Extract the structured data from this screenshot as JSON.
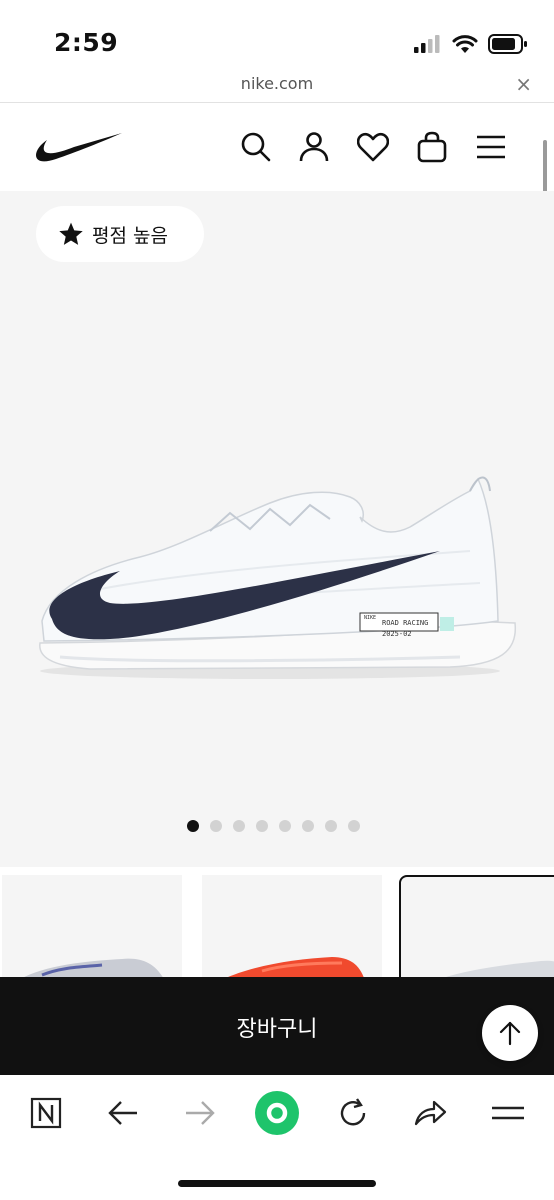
{
  "status_bar": {
    "time": "2:59"
  },
  "url_bar": {
    "domain": "nike.com",
    "close_glyph": "×"
  },
  "header": {
    "logo": "nike-swoosh-logo",
    "icons": [
      "search-icon",
      "account-icon",
      "favorites-heart-icon",
      "bag-icon",
      "menu-icon"
    ]
  },
  "gallery": {
    "badge_label": "평점 높음",
    "badge_icon": "star-icon",
    "dots_count": 8,
    "active_dot": 1,
    "shoe_label_line1": "ROAD RACING",
    "shoe_label_line2": "2025-02",
    "shoe_label_brand": "NIKE"
  },
  "thumbnails": [
    {
      "color": "white-blue"
    },
    {
      "color": "red"
    },
    {
      "color": "white",
      "selected": true
    }
  ],
  "cart": {
    "label": "장바구니"
  },
  "toolbar": {
    "icons": [
      "naver-n-icon",
      "back-arrow-icon",
      "forward-arrow-icon",
      "green-home-icon",
      "reload-icon",
      "share-icon",
      "menu-icon"
    ]
  },
  "colors": {
    "black": "#111111",
    "gallery_bg": "#f5f5f5",
    "accent_green": "#1ec46b"
  }
}
